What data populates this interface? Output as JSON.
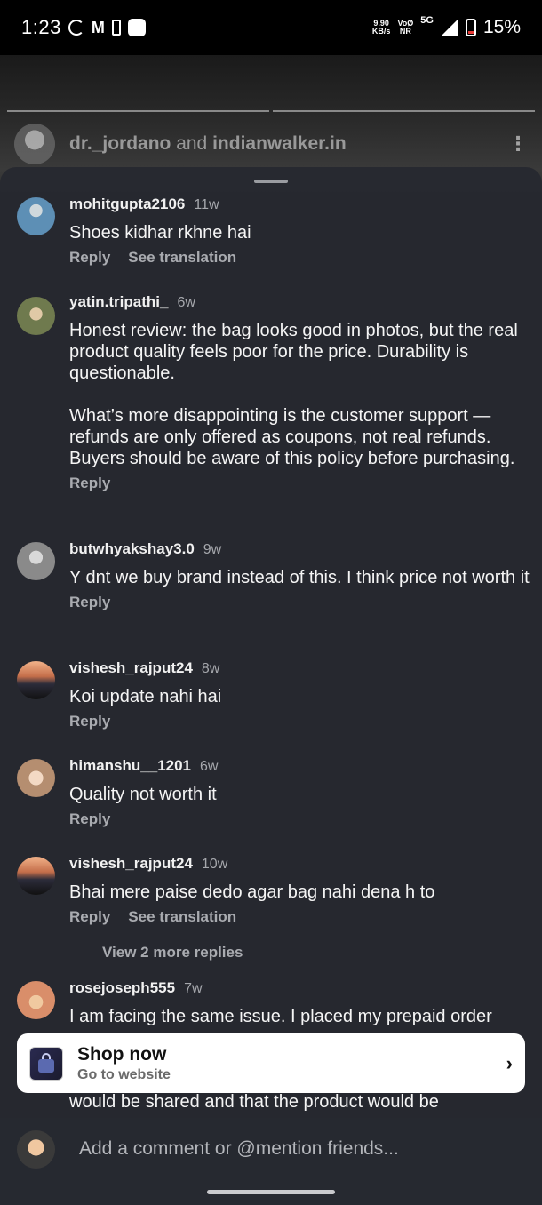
{
  "status_bar": {
    "time": "1:23",
    "net_speed_top": "9.90",
    "net_speed_bottom": "KB/s",
    "volte_top": "VoØ",
    "volte_bottom": "NR",
    "network": "5G",
    "battery": "15%",
    "battery_color": "#e53935"
  },
  "story": {
    "user1": "dr._jordano",
    "and_text": "and",
    "user2": "indianwalker.in",
    "more_icon": "more-vertical-icon"
  },
  "comments": [
    {
      "username": "mohitgupta2106",
      "time": "11w",
      "text": "Shoes kidhar rkhne hai",
      "reply": "Reply",
      "translate": "See translation"
    },
    {
      "username": "yatin.tripathi_",
      "time": "6w",
      "text": "Honest review: the bag looks good in photos, but the real product quality feels poor for the price. Durability is questionable.\n\nWhat’s more disappointing is the customer support — refunds are only offered as coupons, not real refunds. Buyers should be aware of this policy before purchasing.",
      "reply": "Reply"
    },
    {
      "username": "butwhyakshay3.0",
      "time": "9w",
      "text": "Y dnt we buy brand instead of this. I think price not worth it",
      "reply": "Reply"
    },
    {
      "username": "vishesh_rajput24",
      "time": "8w",
      "text": "Koi update nahi hai",
      "reply": "Reply"
    },
    {
      "username": "himanshu__1201",
      "time": "6w",
      "text": "Quality not worth it",
      "reply": "Reply"
    },
    {
      "username": "vishesh_rajput24",
      "time": "10w",
      "text": "Bhai mere paise dedo agar bag nahi dena h to",
      "reply": "Reply",
      "translate": "See translation",
      "more_replies": "View 2 more replies"
    },
    {
      "username": "rosejoseph555",
      "time": "7w",
      "text": "I am facing the same issue. I placed my prepaid order",
      "text_tail": "would be shared and that the product would be"
    }
  ],
  "shop": {
    "title": "Shop now",
    "subtitle": "Go to website",
    "chevron": "›"
  },
  "composer": {
    "placeholder": "Add a comment or @mention friends..."
  }
}
